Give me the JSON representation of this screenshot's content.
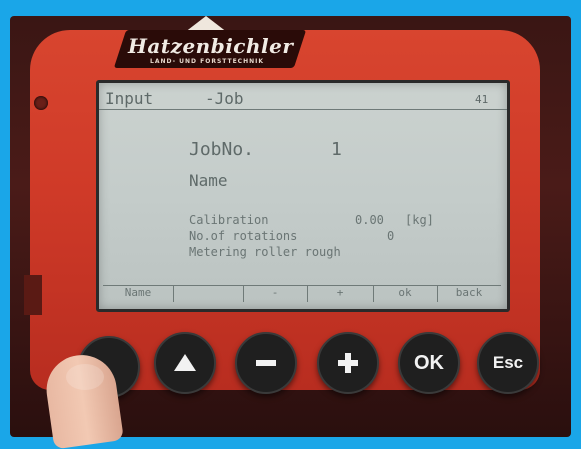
{
  "device": {
    "brand_logo_text": "Hatzenbichler",
    "brand_logo_subtext": "LAND- UND FORSTTECHNIK",
    "colors": {
      "frame": "#1aa6e8",
      "panel": "#d0402c",
      "lcd": "#c7cfcd",
      "lcd_text": "#5f6a69"
    }
  },
  "lcd": {
    "header": {
      "left": "Input",
      "title": "-Job",
      "right": "41"
    },
    "job_no_label": "JobNo.",
    "job_no_value": "1",
    "name_label": "Name",
    "calibration_label": "Calibration",
    "calibration_value": "0.00",
    "calibration_unit": "[kg]",
    "rotations_label": "No.of rotations",
    "rotations_value": "0",
    "metering_label": "Metering roller rough",
    "softkeys": [
      "Name",
      "",
      "-",
      "+",
      "ok",
      "back"
    ]
  },
  "buttons": {
    "b1_icon": "blank-button-icon",
    "b2_icon": "up-triangle-icon",
    "b3_icon": "minus-icon",
    "b4_icon": "plus-icon",
    "ok_label": "OK",
    "esc_label": "Esc"
  }
}
